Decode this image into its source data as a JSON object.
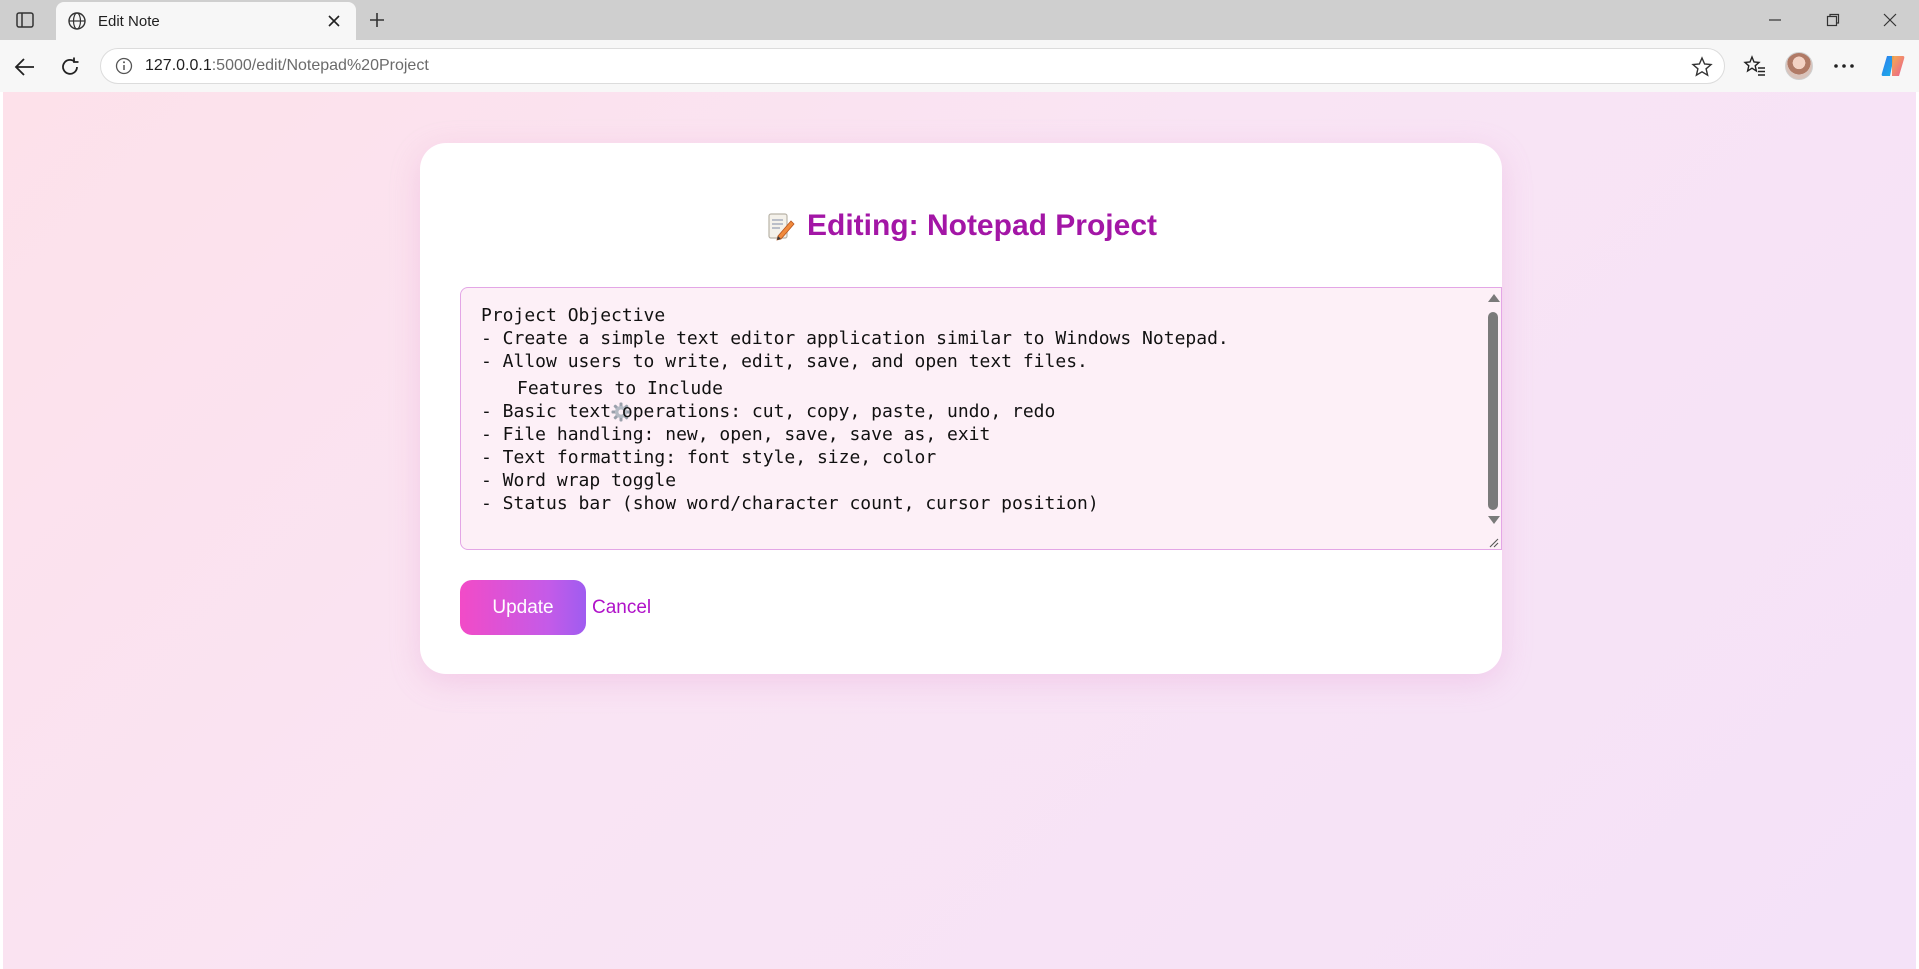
{
  "browser": {
    "tab": {
      "title": "Edit Note",
      "favicon": "globe-icon"
    },
    "address": {
      "host": "127.0.0.1",
      "path": ":5000/edit/Notepad%20Project"
    },
    "icons": [
      "sidebar-toggle-icon",
      "close-icon",
      "plus-icon",
      "minimize-icon",
      "restore-icon",
      "close-window-icon",
      "back-icon",
      "reload-icon",
      "info-icon",
      "star-icon",
      "favorites-icon",
      "avatar",
      "more-icon",
      "copilot-icon"
    ]
  },
  "page": {
    "heading_icon": "memo-icon",
    "heading": "Editing: Notepad Project",
    "editor": {
      "lines": [
        "Project Objective",
        "- Create a simple text editor application similar to Windows Notepad.",
        "- Allow users to write, edit, save, and open text files.",
        "Features to Include",
        "- Basic text operations: cut, copy, paste, undo, redo",
        "- File handling: new, open, save, save as, exit",
        "- Text formatting: font style, size, color",
        "- Word wrap toggle",
        "- Status bar (show word/character count, cursor position)"
      ],
      "emoji_line_icon": "gear-icon"
    },
    "update_label": "Update",
    "cancel_label": "Cancel",
    "colors": {
      "heading": "#a316a6",
      "editor_border": "#e3a6e6",
      "editor_bg": "#fdf0f7",
      "button_start": "#f24bc7",
      "button_end": "#9f5cf0",
      "cancel": "#b012c9"
    }
  }
}
